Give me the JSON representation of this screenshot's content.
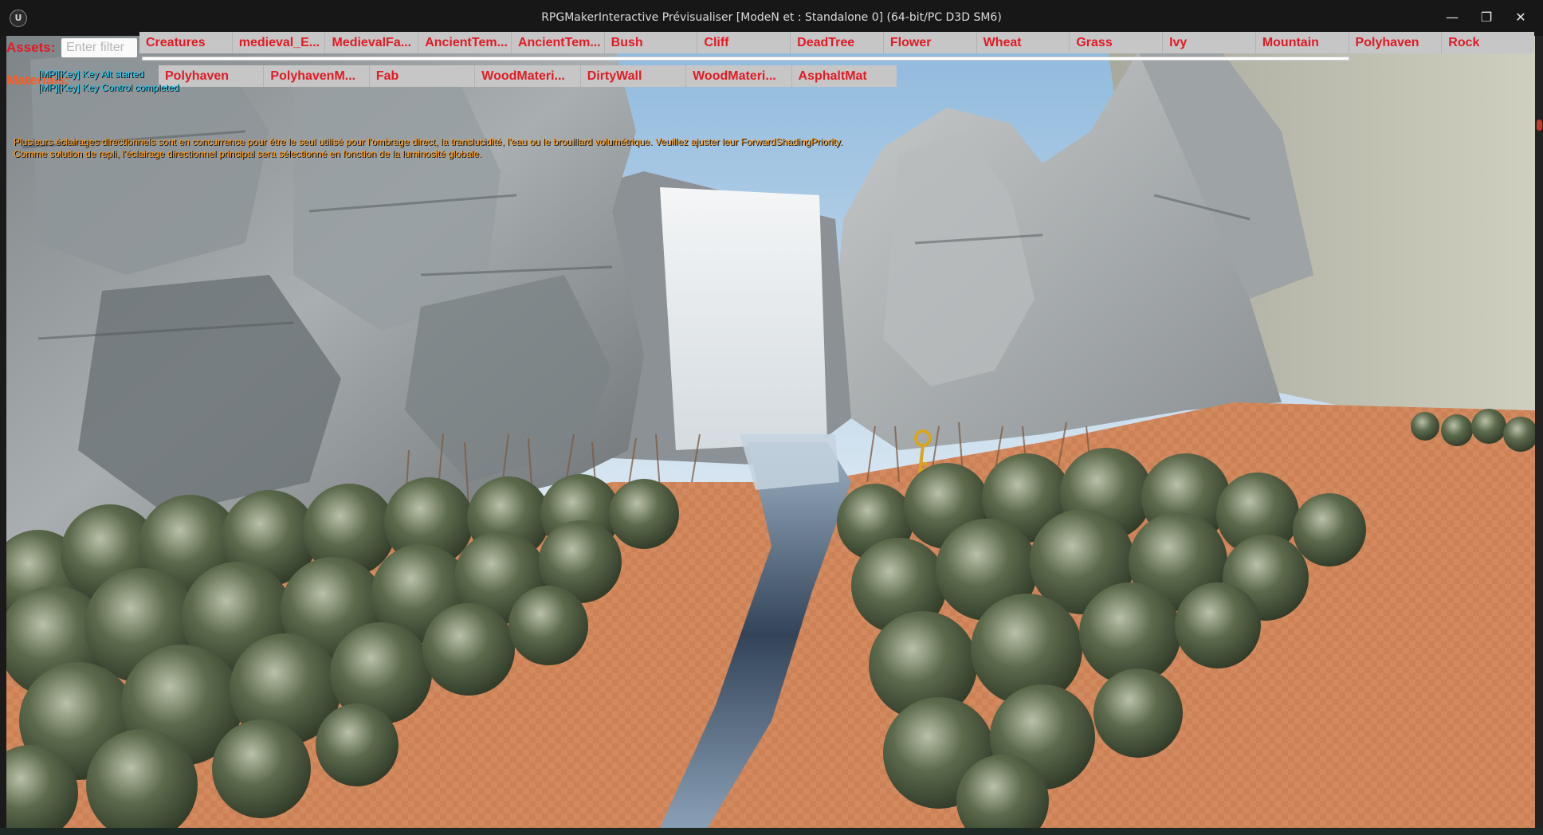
{
  "window": {
    "title": "RPGMakerInteractive Prévisualiser [ModeN et : Standalone 0]  (64-bit/PC D3D SM6)",
    "minimize_glyph": "—",
    "maximize_glyph": "❐",
    "close_glyph": "✕",
    "logo_glyph": "U"
  },
  "toolbar": {
    "assets_label": "Assets:",
    "materials_label": "Materials:",
    "filter_placeholder": "Enter filter",
    "asset_categories": [
      "Creatures",
      "medieval_E...",
      "MedievalFa...",
      "AncientTem...",
      "AncientTem...",
      "Bush",
      "Cliff",
      "DeadTree",
      "Flower",
      "Wheat",
      "Grass",
      "Ivy",
      "Mountain",
      "Polyhaven",
      "Rock"
    ],
    "material_categories": [
      "Polyhaven",
      "PolyhavenM...",
      "Fab",
      "WoodMateri...",
      "DirtyWall",
      "WoodMateri...",
      "AsphaltMat"
    ]
  },
  "log": {
    "lines": [
      "[MP][Key] Key Alt started",
      "[MP][Key] Key Control completed"
    ]
  },
  "warning": {
    "lines": [
      "Plusieurs éclairages directionnels sont en concurrence pour être le seul utilisé pour l'ombrage direct, la translucidité, l'eau ou le brouillard volumétrique. Veuillez ajuster leur ForwardShadingPriority.",
      "Comme solution de repli, l'éclairage directionnel principal sera sélectionné en fonction de la luminosité globale."
    ]
  },
  "colors": {
    "label_red": "#e01b24",
    "log_cyan": "#22c8f0",
    "warning_orange": "#ff9a1a",
    "sand": "#d98a5a",
    "sky": "#a9cbe6"
  }
}
